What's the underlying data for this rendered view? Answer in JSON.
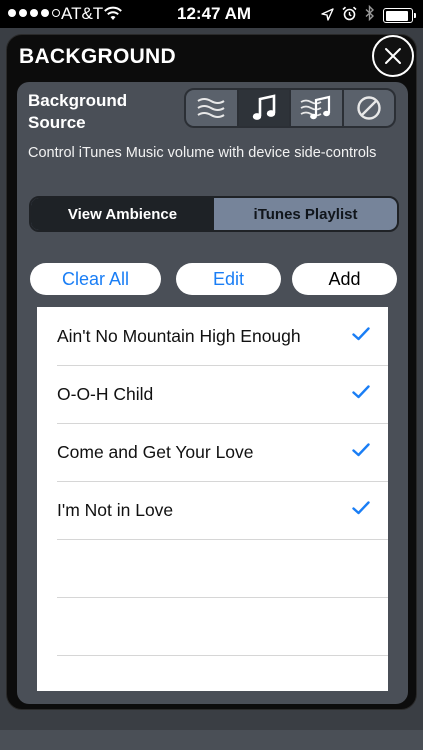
{
  "status_bar": {
    "carrier": "AT&T",
    "time": "12:47 AM",
    "signal_bars_filled": 4,
    "signal_bars_total": 5,
    "battery_level": 0.9
  },
  "panel": {
    "title": "BACKGROUND",
    "close_icon": "close-icon"
  },
  "background_source": {
    "label_line1": "Background",
    "label_line2": "Source",
    "options": [
      {
        "icon": "waves-icon",
        "active": false
      },
      {
        "icon": "music-note-icon",
        "active": true
      },
      {
        "icon": "waves-music-icon",
        "active": false
      },
      {
        "icon": "none-icon",
        "active": false
      }
    ]
  },
  "description": "Control iTunes Music volume with device side-controls",
  "mode": {
    "tabs": [
      {
        "label": "View Ambience",
        "active": true
      },
      {
        "label": "iTunes Playlist",
        "active": false
      }
    ]
  },
  "actions": {
    "clear_all": "Clear All",
    "edit": "Edit",
    "add": "Add"
  },
  "playlist": {
    "items": [
      {
        "title": "Ain't No Mountain High Enough",
        "checked": true
      },
      {
        "title": "O-O-H Child",
        "checked": true
      },
      {
        "title": "Come and Get Your Love",
        "checked": true
      },
      {
        "title": "I'm Not in Love",
        "checked": true
      }
    ]
  },
  "colors": {
    "accent_blue": "#1a7ef5",
    "panel_bg": "#0c0c0c",
    "inner_bg": "#4a4f57",
    "segment_inactive": "#76849a"
  }
}
